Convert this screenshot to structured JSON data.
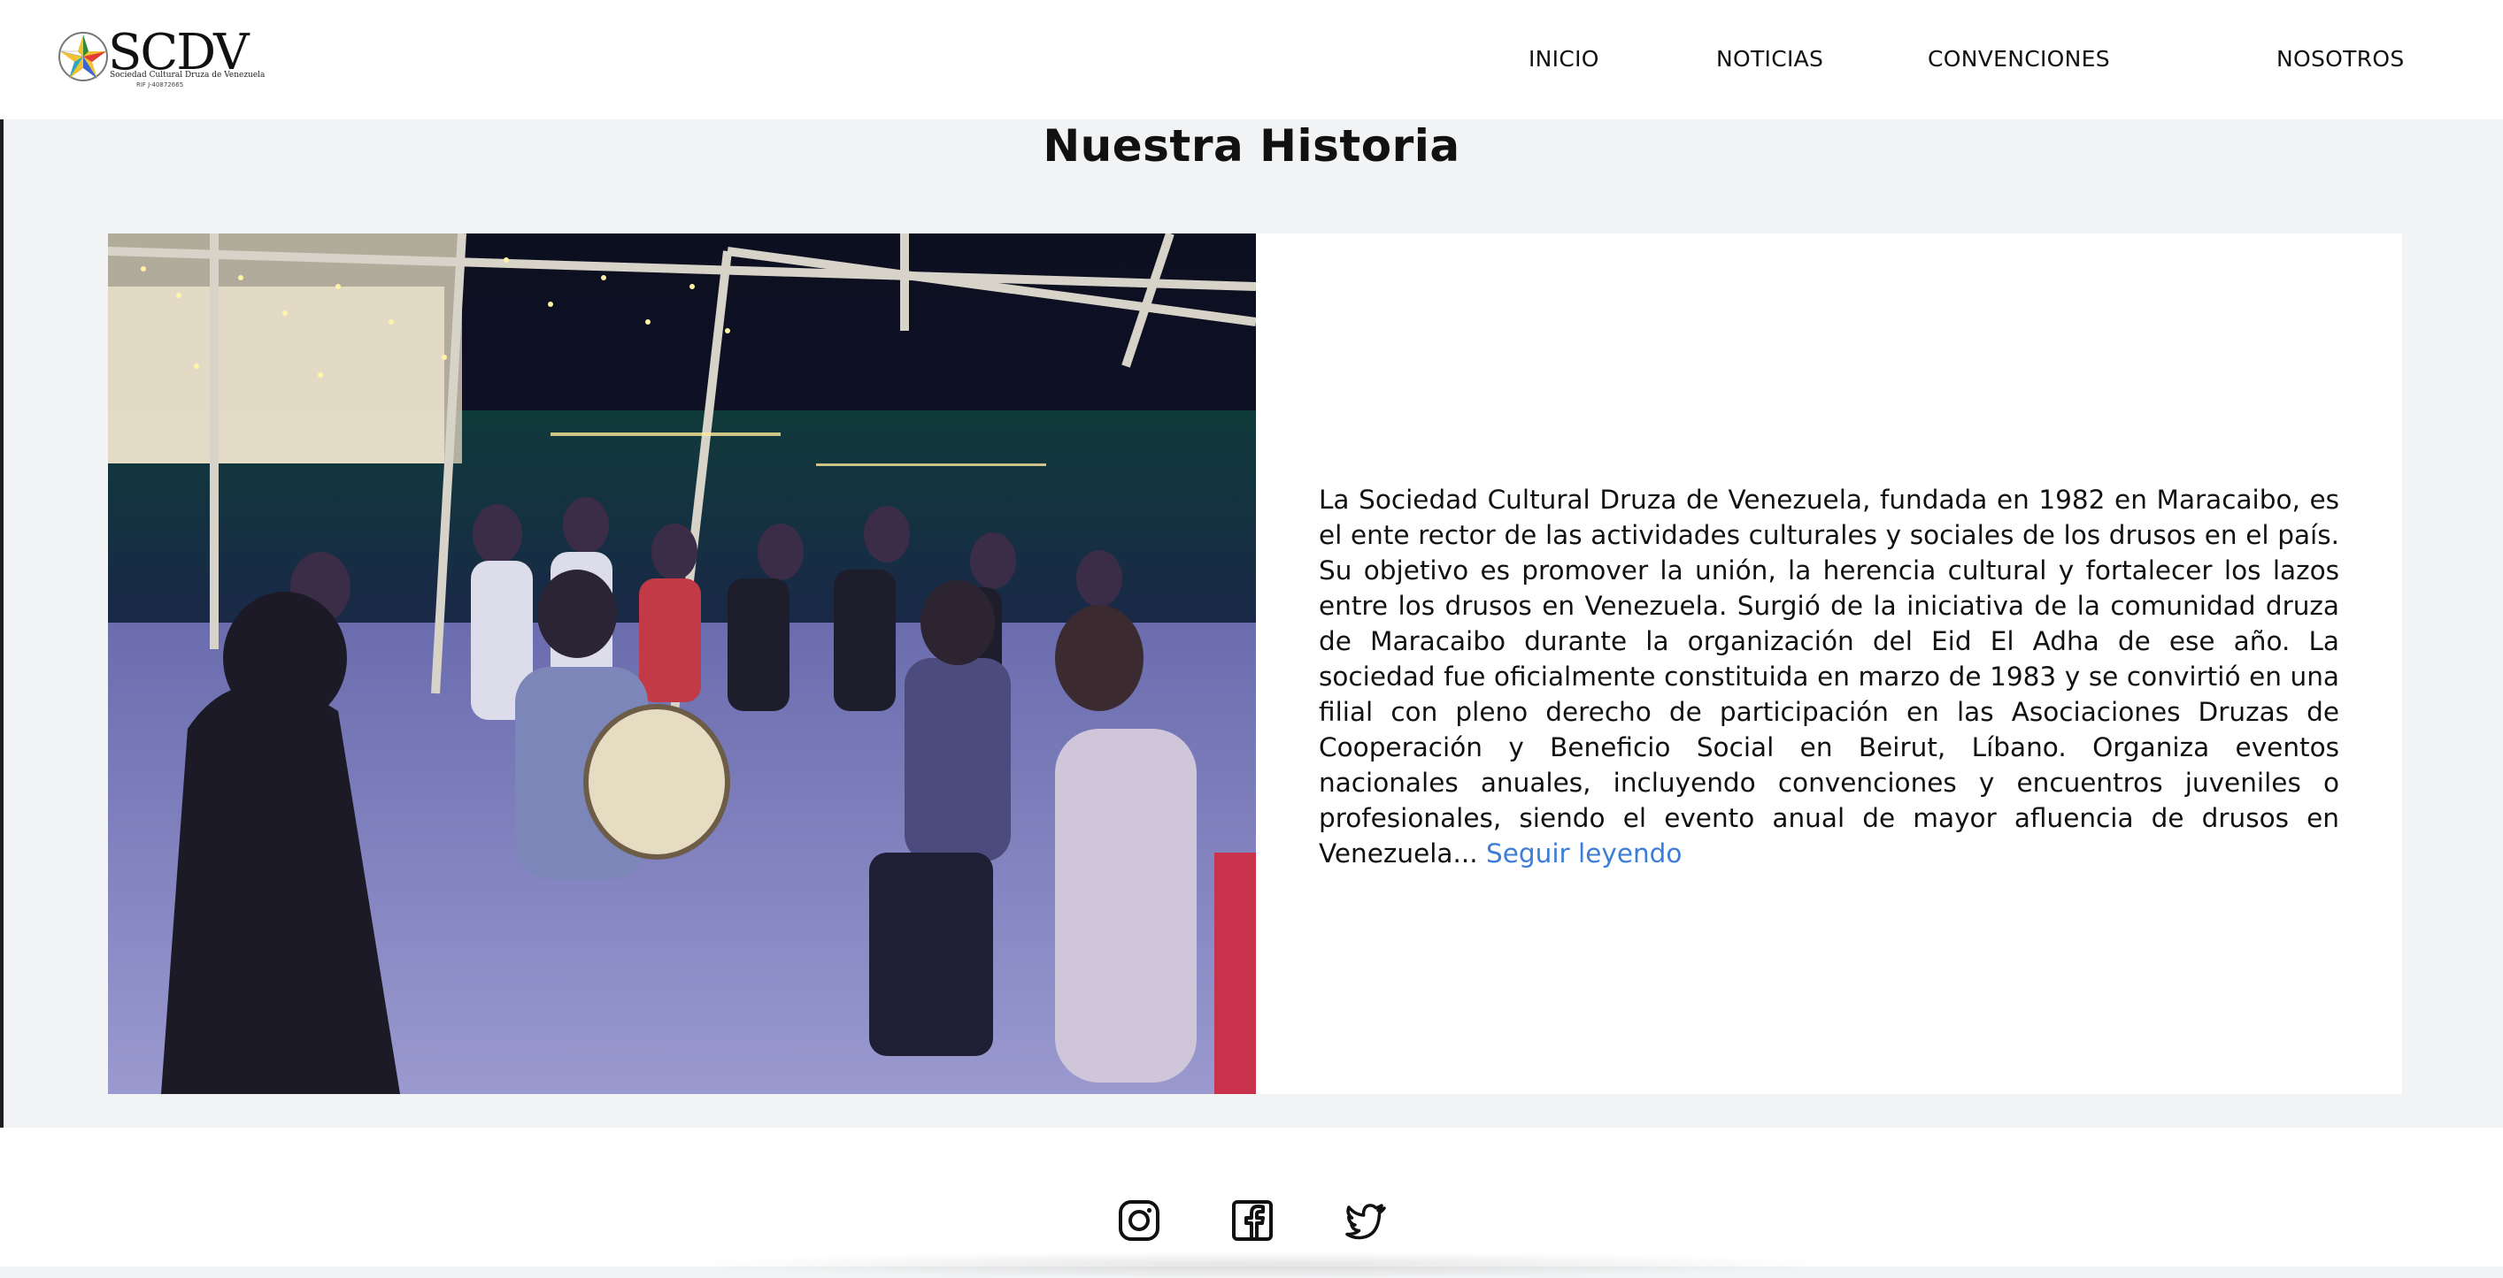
{
  "brand": {
    "name": "SCDV",
    "subtitle": "Sociedad Cultural Druza de Venezuela",
    "tagline": "RIF J-40872665"
  },
  "nav": {
    "items": [
      "INICIO",
      "NOTICIAS",
      "CONVENCIONES",
      "NOSOTROS"
    ]
  },
  "history": {
    "title": "Nuestra Historia",
    "body": "La Sociedad Cultural Druza de Venezuela, fundada en 1982 en Maracaibo, es el ente rector de las actividades culturales y sociales de los drusos en el país. Su objetivo es promover la unión, la herencia cultural y fortalecer los lazos entre los drusos en Venezuela. Surgió de la iniciativa de la comunidad druza de Maracaibo durante la organización del Eid El Adha de ese año. La sociedad fue oficialmente constituida en marzo de 1983 y se convirtió en una filial con pleno derecho de participación en las Asociaciones Druzas de Cooperación y Beneficio Social en Beirut, Líbano. Organiza eventos nacionales anuales, incluyendo convenciones y encuentros juveniles o profesionales, siendo el evento anual de mayor afluencia de drusos en Venezuela...",
    "read_more": "Seguir leyendo",
    "photo_icon": "photo-people-dancing"
  },
  "footer": {
    "social": [
      "instagram-icon",
      "facebook-icon",
      "twitter-icon"
    ]
  },
  "colors": {
    "page_bg": "#f2f3f4",
    "link": "#3b7dd8",
    "text": "#111111"
  }
}
